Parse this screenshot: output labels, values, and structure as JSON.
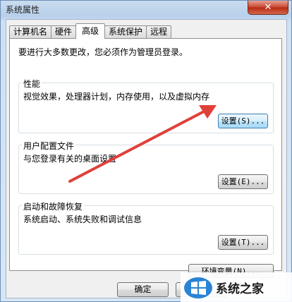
{
  "window": {
    "title": "系统属性",
    "close_label": "✕"
  },
  "tabs": [
    {
      "label": "计算机名",
      "active": false
    },
    {
      "label": "硬件",
      "active": false
    },
    {
      "label": "高级",
      "active": true
    },
    {
      "label": "系统保护",
      "active": false
    },
    {
      "label": "远程",
      "active": false
    }
  ],
  "advanced": {
    "admin_note": "要进行大多数更改，您必须作为管理员登录。",
    "performance": {
      "title": "性能",
      "desc": "视觉效果，处理器计划，内存使用，以及虚拟内存",
      "button": "设置(S)..."
    },
    "user_profiles": {
      "title": "用户配置文件",
      "desc": "与您登录有关的桌面设置",
      "button": "设置(E)..."
    },
    "startup_recovery": {
      "title": "启动和故障恢复",
      "desc": "系统启动、系统失败和调试信息",
      "button": "设置(T)..."
    },
    "env_button": "环境变量(N)..."
  },
  "footer": {
    "ok_label": "确定"
  },
  "annotation": {
    "arrow_color": "#e0403a"
  },
  "watermark": {
    "text": "系统之家",
    "icon": "windows-logo-icon"
  }
}
